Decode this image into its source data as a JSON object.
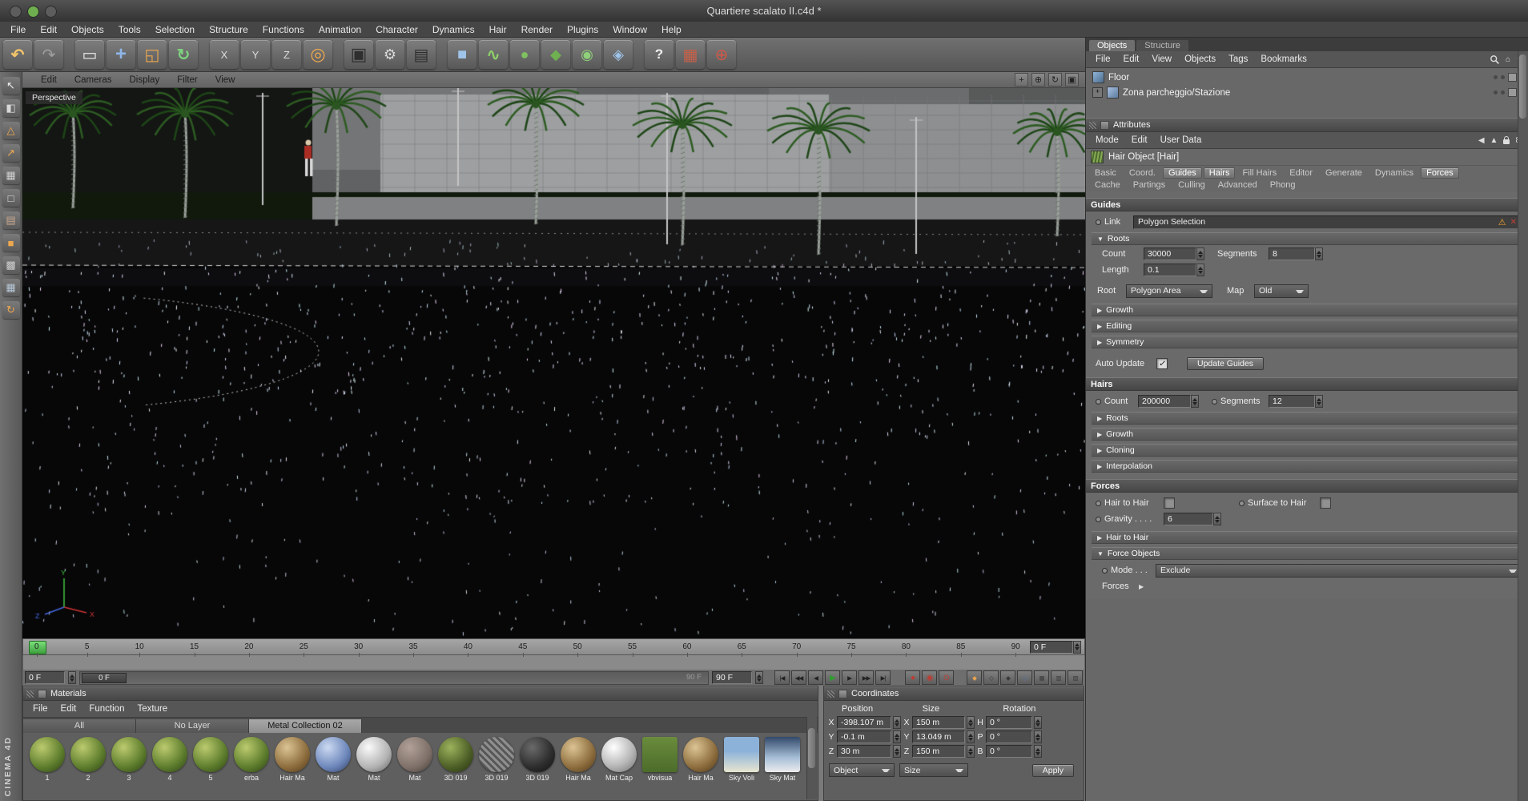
{
  "window": {
    "title": "Quartiere scalato II.c4d *"
  },
  "ui": {
    "collapsed_arrow": "▶",
    "expanded_arrow": "▼",
    "check": "✓",
    "warning": "⚠",
    "close": "✕",
    "back": "◀",
    "up": "▲",
    "link8": "8",
    "home": "⌂",
    "uparrow": "↑",
    "forces_arrow": "▶"
  },
  "menubar": {
    "items": [
      "File",
      "Edit",
      "Objects",
      "Tools",
      "Selection",
      "Structure",
      "Functions",
      "Animation",
      "Character",
      "Dynamics",
      "Hair",
      "Render",
      "Plugins",
      "Window",
      "Help"
    ]
  },
  "toolbar": {
    "icons": [
      {
        "name": "undo-icon",
        "glyph": "↶",
        "style": "color:#f2c46a;font-weight:bold"
      },
      {
        "name": "redo-icon",
        "glyph": "↷",
        "style": "color:#9f9f9f"
      },
      {
        "name": "toolbar-separator",
        "kind": "sep",
        "glyph": ""
      },
      {
        "name": "live-selection-icon",
        "glyph": "▭",
        "style": "color:#ececec"
      },
      {
        "name": "move-tool-icon",
        "glyph": "+",
        "style": "color:#8fb6e8;font-weight:bold;font-size:24px"
      },
      {
        "name": "scale-tool-icon",
        "glyph": "◱",
        "style": "color:#f0a84e"
      },
      {
        "name": "rotate-tool-icon",
        "glyph": "↻",
        "style": "color:#7fd07f;font-weight:bold"
      },
      {
        "name": "toolbar-separator",
        "kind": "sep",
        "glyph": ""
      },
      {
        "name": "lock-x-axis-icon",
        "glyph": "X",
        "style": "color:#dcdcdc;font-size:13px"
      },
      {
        "name": "lock-y-axis-icon",
        "glyph": "Y",
        "style": "color:#dcdcdc;font-size:13px"
      },
      {
        "name": "lock-z-axis-icon",
        "glyph": "Z",
        "style": "color:#dcdcdc;font-size:13px"
      },
      {
        "name": "coordinate-system-icon",
        "glyph": "◎",
        "style": "color:#f0a84e;font-size:22px"
      },
      {
        "name": "toolbar-separator",
        "kind": "sep",
        "glyph": ""
      },
      {
        "name": "render-view-icon",
        "glyph": "▣",
        "style": "color:#2e2e2e;font-size:22px"
      },
      {
        "name": "render-settings-icon",
        "glyph": "⚙",
        "style": "color:#d8d8d8;font-size:18px"
      },
      {
        "name": "render-queue-icon",
        "glyph": "▤",
        "style": "color:#2e2e2e;font-size:20px"
      },
      {
        "name": "toolbar-separator",
        "kind": "sep",
        "glyph": ""
      },
      {
        "name": "add-primitive-icon",
        "glyph": "■",
        "style": "color:#9fc4ea;font-size:20px"
      },
      {
        "name": "add-spline-icon",
        "glyph": "∿",
        "style": "color:#8fd06a;font-weight:bold;font-size:20px"
      },
      {
        "name": "add-generator-icon",
        "glyph": "●",
        "style": "color:#7fc060;font-size:18px"
      },
      {
        "name": "add-modeling-icon",
        "glyph": "◆",
        "style": "color:#6fb050;font-size:18px"
      },
      {
        "name": "add-dynamics-icon",
        "glyph": "◉",
        "style": "color:#8fd07a;font-size:18px"
      },
      {
        "name": "add-deformer-icon",
        "glyph": "◈",
        "style": "color:#9fc4ea;font-size:18px"
      },
      {
        "name": "toolbar-separator",
        "kind": "sep",
        "glyph": ""
      },
      {
        "name": "help-pointer-icon",
        "glyph": "?",
        "style": "color:#f0f0f0;font-weight:bold;font-size:17px"
      },
      {
        "name": "content-browser-icon",
        "glyph": "▦",
        "style": "color:#c86048;font-size:20px"
      },
      {
        "name": "online-updater-icon",
        "glyph": "⊕",
        "style": "color:#d05848;font-size:20px"
      }
    ]
  },
  "left_toolbar": {
    "icons": [
      {
        "name": "camera-mode-icon",
        "glyph": "↖",
        "style": "color:#f0f0f0"
      },
      {
        "name": "model-mode-icon",
        "glyph": "◧",
        "style": "color:#d8d8d8"
      },
      {
        "name": "texture-mode-icon",
        "glyph": "△",
        "style": "color:#f0a84e"
      },
      {
        "name": "workplane-mode-icon",
        "glyph": "↗",
        "style": "color:#f0a84e"
      },
      {
        "name": "points-mode-icon",
        "glyph": "▦",
        "style": "color:#d0d0d0"
      },
      {
        "name": "edges-mode-icon",
        "glyph": "□",
        "style": "color:#e0e0e0"
      },
      {
        "name": "polygons-mode-icon",
        "glyph": "▤",
        "style": "color:#c8a890"
      },
      {
        "name": "enable-axis-icon",
        "glyph": "■",
        "style": "color:#f0a84e"
      },
      {
        "name": "viewport-solo-icon",
        "glyph": "▩",
        "style": "color:#d0d0d0"
      },
      {
        "name": "snap-settings-icon",
        "glyph": "▦",
        "style": "color:#b8c8d8"
      },
      {
        "name": "enable-quantize-icon",
        "glyph": "↻",
        "style": "color:#f0a84e"
      }
    ]
  },
  "viewport": {
    "label": "Perspective",
    "menu": [
      "Edit",
      "Cameras",
      "Display",
      "Filter",
      "View"
    ],
    "nav_icons": [
      {
        "name": "pan-view-icon",
        "glyph": "+"
      },
      {
        "name": "zoom-view-icon",
        "glyph": "⊕"
      },
      {
        "name": "rotate-view-icon",
        "glyph": "↻"
      },
      {
        "name": "toggle-view-icon",
        "glyph": "▣"
      }
    ]
  },
  "timeline": {
    "ticks": [
      "0",
      "5",
      "10",
      "15",
      "20",
      "25",
      "30",
      "35",
      "40",
      "45",
      "50",
      "55",
      "60",
      "65",
      "70",
      "75",
      "80",
      "85",
      "90"
    ],
    "frame_field": "0 F",
    "start_field": "0 F",
    "slider_thumb": "0 F",
    "slider_end_label": "90 F",
    "end_field": "90 F",
    "transport": [
      {
        "name": "goto-start-button",
        "glyph": "|◀"
      },
      {
        "name": "prev-key-button",
        "glyph": "◀◀"
      },
      {
        "name": "prev-frame-button",
        "glyph": "◀"
      },
      {
        "name": "play-button",
        "glyph": "▶",
        "style": "color:#2f9e2f;font-size:10px"
      },
      {
        "name": "next-frame-button",
        "glyph": "▶"
      },
      {
        "name": "next-key-button",
        "glyph": "▶▶"
      },
      {
        "name": "goto-end-button",
        "glyph": "▶|"
      }
    ],
    "record": [
      {
        "name": "record-keyframe-button",
        "glyph": "●",
        "style": "color:#c03a30;font-size:10px"
      },
      {
        "name": "autokey-button",
        "glyph": "◉",
        "style": "color:#c03a30;font-size:10px"
      },
      {
        "name": "record-options-button",
        "glyph": "⊙",
        "style": "color:#c03a30;font-size:10px"
      }
    ],
    "toggles": [
      {
        "name": "position-key-toggle",
        "glyph": "◆",
        "style": "color:#e8a44e"
      },
      {
        "name": "scale-key-toggle",
        "glyph": "◇",
        "style": "color:#3a3a3a"
      },
      {
        "name": "rotation-key-toggle",
        "glyph": "◆",
        "style": "color:#3a3a3a"
      },
      {
        "name": "parameter-key-toggle",
        "glyph": "◇",
        "style": "color:#5a7ab0"
      },
      {
        "name": "pla-key-toggle",
        "glyph": "▦",
        "style": "color:#3a3a3a"
      },
      {
        "name": "keyframe-selection-toggle",
        "glyph": "▥",
        "style": "color:#3a3a3a"
      },
      {
        "name": "timeline-options-toggle",
        "glyph": "▨",
        "style": "color:#3a3a3a"
      }
    ]
  },
  "materials": {
    "header": "Materials",
    "menu": [
      "File",
      "Edit",
      "Function",
      "Texture"
    ],
    "tabs": [
      {
        "label": "All"
      },
      {
        "label": "No Layer"
      },
      {
        "label": "Metal Collection 02",
        "active": true
      }
    ],
    "items": [
      {
        "label": "1",
        "type": "green"
      },
      {
        "label": "2",
        "type": "green"
      },
      {
        "label": "3",
        "type": "green"
      },
      {
        "label": "4",
        "type": "green"
      },
      {
        "label": "5",
        "type": "green"
      },
      {
        "label": "erba",
        "type": "green"
      },
      {
        "label": "Hair Ma",
        "type": "hair"
      },
      {
        "label": "Mat",
        "type": "blue"
      },
      {
        "label": "Mat",
        "type": "white"
      },
      {
        "label": "Mat",
        "type": "brick"
      },
      {
        "label": "3D 019",
        "type": "moss"
      },
      {
        "label": "3D 019",
        "type": "fabric"
      },
      {
        "label": "3D 019",
        "type": "dark"
      },
      {
        "label": "Hair Ma",
        "type": "hair"
      },
      {
        "label": "Mat Cap",
        "type": "chrome"
      },
      {
        "label": "vbvisua",
        "type": "flatgreen"
      },
      {
        "label": "Hair Ma",
        "type": "hair"
      },
      {
        "label": "Sky Voli",
        "type": "sky"
      },
      {
        "label": "Sky Mat",
        "type": "sky2"
      }
    ]
  },
  "coordinates": {
    "header": "Coordinates",
    "colum": "",
    "columns": [
      "Position",
      "Size",
      "Rotation"
    ],
    "rows": [
      {
        "a1": "X",
        "v1": "-398.107 m",
        "a2": "X",
        "v2": "150 m",
        "a3": "H",
        "v3": "0 °"
      },
      {
        "a1": "Y",
        "v1": "-0.1 m",
        "a2": "Y",
        "v2": "13.049 m",
        "a3": "P",
        "v3": "0 °"
      },
      {
        "a1": "Z",
        "v1": "30 m",
        "a2": "Z",
        "v2": "150 m",
        "a3": "B",
        "v3": "0 °"
      }
    ],
    "object_dropdown": "Object",
    "size_dropdown": "Size",
    "apply_button": "Apply"
  },
  "object_manager": {
    "tabs": [
      {
        "label": "Objects",
        "active": true
      },
      {
        "label": "Structure"
      }
    ],
    "menu": [
      "File",
      "Edit",
      "View",
      "Objects",
      "Tags",
      "Bookmarks"
    ],
    "items": [
      {
        "label": "Floor"
      },
      {
        "label": "Zona parcheggio/Stazione",
        "expander": "+"
      }
    ]
  },
  "attributes": {
    "header": "Attributes",
    "menu": [
      "Mode",
      "Edit",
      "User Data"
    ],
    "object_title": "Hair Object [Hair]",
    "tabs_row1": [
      {
        "label": "Basic"
      },
      {
        "label": "Coord."
      },
      {
        "label": "Guides",
        "active": true
      },
      {
        "label": "Hairs",
        "active": true
      },
      {
        "label": "Fill Hairs"
      },
      {
        "label": "Editor"
      },
      {
        "label": "Generate"
      },
      {
        "label": "Dynamics"
      },
      {
        "label": "Forces",
        "active": true
      }
    ],
    "tabs_row2": [
      {
        "label": "Cache"
      },
      {
        "label": "Partings"
      },
      {
        "label": "Culling"
      },
      {
        "label": "Advanced"
      },
      {
        "label": "Phong"
      }
    ],
    "guides": {
      "header": "Guides",
      "link_label": "Link",
      "link_value": "Polygon Selection",
      "roots_label": "Roots",
      "count_label": "Count",
      "count_value": "30000",
      "segments_label": "Segments",
      "segments_value": "8",
      "length_label": "Length",
      "length_value": "0.1",
      "root_label": "Root",
      "root_value": "Polygon Area",
      "map_label": "Map",
      "map_value": "Old",
      "growth_label": "Growth",
      "editing_label": "Editing",
      "symmetry_label": "Symmetry",
      "auto_update_label": "Auto Update",
      "update_button": "Update Guides"
    },
    "hairs": {
      "header": "Hairs",
      "count_label": "Count",
      "count_value": "200000",
      "segments_label": "Segments",
      "segments_value": "12",
      "roots_label": "Roots",
      "growth_label": "Growth",
      "cloning_label": "Cloning",
      "interpolation_label": "Interpolation"
    },
    "forces": {
      "header": "Forces",
      "hair_to_hair_label": "Hair to Hair",
      "surface_to_hair_label": "Surface to Hair",
      "gravity_label": "Gravity . . . .",
      "gravity_value": "6",
      "hair_to_hair_section": "Hair to Hair",
      "force_objects_label": "Force Objects",
      "mode_label": "Mode . . .",
      "mode_value": "Exclude",
      "forces_label": "Forces"
    }
  },
  "branding": {
    "vertical_text": "CINEMA 4D"
  }
}
